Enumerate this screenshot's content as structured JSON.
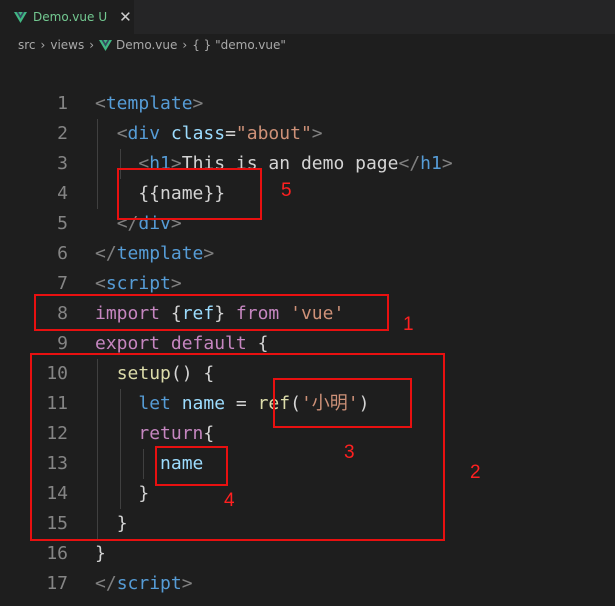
{
  "tab": {
    "filename": "Demo.vue",
    "status": "U",
    "close": "✕"
  },
  "breadcrumb": {
    "src": "src",
    "views": "views",
    "file": "Demo.vue",
    "symbol": "{ } \"demo.vue\""
  },
  "code_lines": [
    {
      "n": "1",
      "tokens": [
        [
          "punc",
          "<"
        ],
        [
          "tag",
          "template"
        ],
        [
          "punc",
          ">"
        ]
      ]
    },
    {
      "n": "2",
      "tokens": [
        [
          "text",
          "  "
        ],
        [
          "punc",
          "<"
        ],
        [
          "tag",
          "div"
        ],
        [
          "text",
          " "
        ],
        [
          "attr",
          "class"
        ],
        [
          "eq",
          "="
        ],
        [
          "str",
          "\"about\""
        ],
        [
          "punc",
          ">"
        ]
      ]
    },
    {
      "n": "3",
      "tokens": [
        [
          "text",
          "    "
        ],
        [
          "punc",
          "<"
        ],
        [
          "tag",
          "h1"
        ],
        [
          "punc",
          ">"
        ],
        [
          "text",
          "This is an demo page"
        ],
        [
          "punc",
          "</"
        ],
        [
          "tag",
          "h1"
        ],
        [
          "punc",
          ">"
        ]
      ]
    },
    {
      "n": "4",
      "tokens": [
        [
          "text",
          "    {{name}}"
        ]
      ]
    },
    {
      "n": "5",
      "tokens": [
        [
          "text",
          "  "
        ],
        [
          "punc",
          "</"
        ],
        [
          "tag",
          "div"
        ],
        [
          "punc",
          ">"
        ]
      ]
    },
    {
      "n": "6",
      "tokens": [
        [
          "punc",
          "</"
        ],
        [
          "tag",
          "template"
        ],
        [
          "punc",
          ">"
        ]
      ]
    },
    {
      "n": "7",
      "tokens": [
        [
          "punc",
          "<"
        ],
        [
          "tag",
          "script"
        ],
        [
          "punc",
          ">"
        ]
      ]
    },
    {
      "n": "8",
      "tokens": [
        [
          "ctrl",
          "import"
        ],
        [
          "text",
          " "
        ],
        [
          "brace",
          "{"
        ],
        [
          "var",
          "ref"
        ],
        [
          "brace",
          "}"
        ],
        [
          "text",
          " "
        ],
        [
          "ctrl",
          "from"
        ],
        [
          "text",
          " "
        ],
        [
          "str",
          "'vue'"
        ]
      ]
    },
    {
      "n": "9",
      "tokens": [
        [
          "ctrl",
          "export"
        ],
        [
          "text",
          " "
        ],
        [
          "ctrl",
          "default"
        ],
        [
          "text",
          " "
        ],
        [
          "brace",
          "{"
        ]
      ]
    },
    {
      "n": "10",
      "tokens": [
        [
          "text",
          "  "
        ],
        [
          "fn",
          "setup"
        ],
        [
          "text",
          "() {"
        ]
      ]
    },
    {
      "n": "11",
      "tokens": [
        [
          "text",
          "    "
        ],
        [
          "kw",
          "let"
        ],
        [
          "text",
          " "
        ],
        [
          "var",
          "name"
        ],
        [
          "text",
          " = "
        ],
        [
          "fn",
          "ref"
        ],
        [
          "text",
          "("
        ],
        [
          "str",
          "'小明'"
        ],
        [
          "text",
          ")"
        ]
      ]
    },
    {
      "n": "12",
      "tokens": [
        [
          "text",
          "    "
        ],
        [
          "ctrl",
          "return"
        ],
        [
          "brace",
          "{"
        ]
      ]
    },
    {
      "n": "13",
      "tokens": [
        [
          "text",
          "      "
        ],
        [
          "var",
          "name"
        ]
      ]
    },
    {
      "n": "14",
      "tokens": [
        [
          "text",
          "    "
        ],
        [
          "brace",
          "}"
        ]
      ]
    },
    {
      "n": "15",
      "tokens": [
        [
          "text",
          "  "
        ],
        [
          "brace",
          "}"
        ]
      ]
    },
    {
      "n": "16",
      "tokens": [
        [
          "brace",
          "}"
        ]
      ]
    },
    {
      "n": "17",
      "tokens": [
        [
          "punc",
          "</"
        ],
        [
          "tag",
          "script"
        ],
        [
          "punc",
          ">"
        ]
      ]
    }
  ],
  "annotations": {
    "n1": "1",
    "n2": "2",
    "n3": "3",
    "n4": "4",
    "n5": "5",
    "color": "#e81010"
  },
  "colors": {
    "background": "#1e1e1e",
    "tabbar": "#252526",
    "vue_green": "#41b883"
  }
}
